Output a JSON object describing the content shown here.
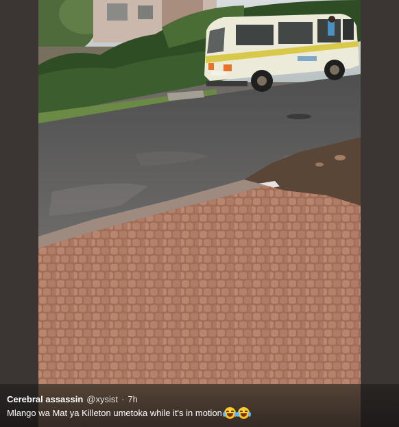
{
  "tweet": {
    "author_name": "Cerebral assassin",
    "author_handle": "@xysist",
    "separator": "·",
    "time": "7h",
    "text": "Mlango wa Mat ya Killeton umetoka while it's in motion",
    "emojis": [
      "face-with-tears-of-joy",
      "face-with-tears-of-joy"
    ]
  },
  "photo": {
    "subject": "matatu-van-on-road",
    "colors": {
      "van_body": "#e9e6d6",
      "van_stripe": "#d9c94a",
      "road": "#5d5c5c",
      "pavers": "#b8826a",
      "foliage": "#2f4d25"
    }
  }
}
